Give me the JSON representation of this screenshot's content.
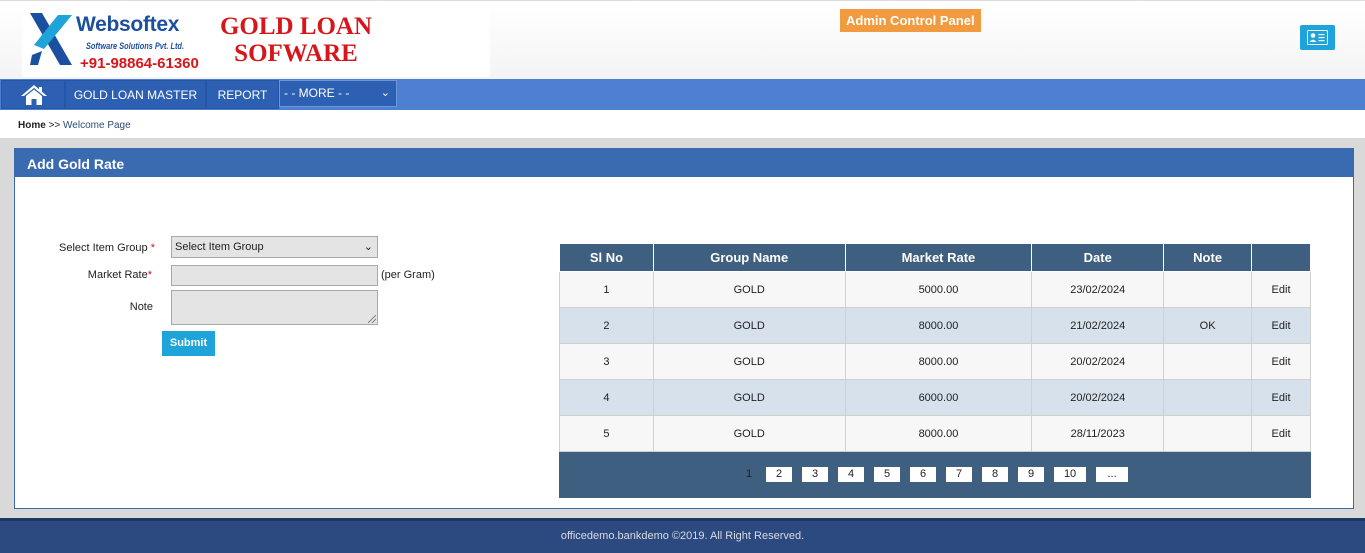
{
  "header": {
    "brand_name": "Websoftex",
    "brand_sub": "Software Solutions Pvt. Ltd.",
    "brand_phone": "+91-98864-61360",
    "product_line1": "GOLD LOAN",
    "product_line2": "SOFWARE",
    "admin_label": "Admin Control Panel",
    "profile_icon": "user-card-icon",
    "colors": {
      "brand_blue": "#1b4fa0",
      "brand_red": "#d7161b",
      "admin_orange": "#f29a3f"
    }
  },
  "nav": {
    "home_icon": "home-icon",
    "items": [
      {
        "label": "GOLD LOAN MASTER"
      },
      {
        "label": "REPORT"
      }
    ],
    "more_label": "- - MORE - -"
  },
  "breadcrumb": {
    "home": "Home",
    "sep": ">>",
    "current": "Welcome Page"
  },
  "panel": {
    "title": "Add Gold Rate",
    "form": {
      "group_label": "Select Item Group",
      "group_selected": "Select Item Group",
      "rate_label": "Market Rate",
      "rate_value": "",
      "rate_unit": "(per Gram)",
      "note_label": "Note",
      "note_value": "",
      "submit_label": "Submit",
      "required_mark": "*"
    },
    "table": {
      "columns": [
        "Sl No",
        "Group Name",
        "Market Rate",
        "Date",
        "Note",
        ""
      ],
      "rows": [
        {
          "sl": "1",
          "group": "GOLD",
          "rate": "5000.00",
          "date": "23/02/2024",
          "note": "",
          "action": "Edit"
        },
        {
          "sl": "2",
          "group": "GOLD",
          "rate": "8000.00",
          "date": "21/02/2024",
          "note": "OK",
          "action": "Edit"
        },
        {
          "sl": "3",
          "group": "GOLD",
          "rate": "8000.00",
          "date": "20/02/2024",
          "note": "",
          "action": "Edit"
        },
        {
          "sl": "4",
          "group": "GOLD",
          "rate": "6000.00",
          "date": "20/02/2024",
          "note": "",
          "action": "Edit"
        },
        {
          "sl": "5",
          "group": "GOLD",
          "rate": "8000.00",
          "date": "28/11/2023",
          "note": "",
          "action": "Edit"
        }
      ],
      "pages": [
        "1",
        "2",
        "3",
        "4",
        "5",
        "6",
        "7",
        "8",
        "9",
        "10",
        "..."
      ],
      "current_page": "1"
    }
  },
  "footer": {
    "text": "officedemo.bankdemo ©2019. All Right Reserved."
  }
}
